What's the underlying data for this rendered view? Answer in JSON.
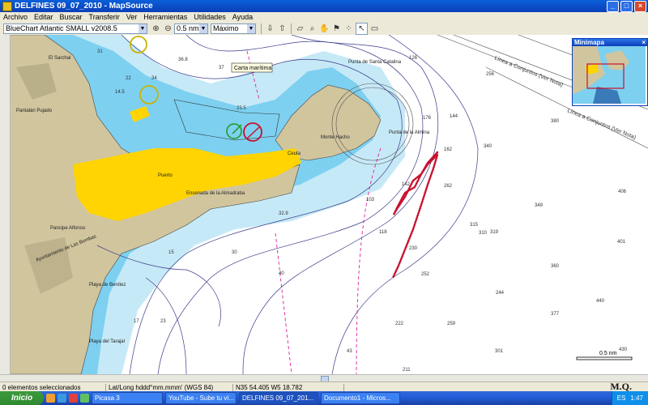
{
  "window": {
    "title": "DELFINES 09_07_2010 - MapSource"
  },
  "menu": [
    "Archivo",
    "Editar",
    "Buscar",
    "Transferir",
    "Ver",
    "Herramientas",
    "Utilidades",
    "Ayuda"
  ],
  "toolbar": {
    "map_product": "BlueChart Atlantic SMALL v2008.5",
    "scale": "0.5 nm",
    "detail": "Máximo"
  },
  "map": {
    "tooltip": "Carta marítima",
    "place_labels": [
      "El Sarchal",
      "Pantalán Pujado",
      "Pancipe Alfonso",
      "Ayuntamiento de Las Bombas",
      "Puerto",
      "Ceuta",
      "Monte Hacho",
      "Punta de Santa Catalina",
      "Punta de la Almina",
      "Ensenada de la Almadraba",
      "Playa de Benítez",
      "Playa del Tarajal"
    ],
    "line_labels": [
      "Línea a Conjuntos (Ver Nota)",
      "Línea a Conjuntos (Ver Nota)"
    ],
    "spot_depths": [
      "31",
      "37",
      "36.8",
      "22",
      "14.5",
      "15",
      "17",
      "23",
      "23.5",
      "34",
      "30",
      "32.9",
      "40",
      "43",
      "103",
      "118",
      "126",
      "142",
      "144",
      "162",
      "176",
      "211",
      "222",
      "230",
      "244",
      "252",
      "256",
      "259",
      "262",
      "301",
      "310",
      "315",
      "319",
      "340",
      "349",
      "360",
      "377",
      "380",
      "401",
      "406",
      "430",
      "440",
      "471"
    ],
    "scale_bar": "0.5 nm"
  },
  "minimap": {
    "title": "Minimapa"
  },
  "status": {
    "selection": "0 elementos seleccionados",
    "coord_format": "Lat/Long hddd°mm.mmm' (WGS 84)",
    "position": "N35 54.405 W5 18.782"
  },
  "watermark": "M.Q.",
  "taskbar": {
    "start": "Inicio",
    "tasks": [
      "Picasa 3",
      "YouTube - Sube tu ví...",
      "DELFINES 09_07_201...",
      "Documento1 - Micros..."
    ],
    "lang": "ES",
    "clock": "1:47"
  },
  "colors": {
    "land": "#d1c59e",
    "urban": "#ffd400",
    "shallow": "#7dd0f0",
    "mid": "#c6e9f7",
    "route": "#c8102e"
  }
}
